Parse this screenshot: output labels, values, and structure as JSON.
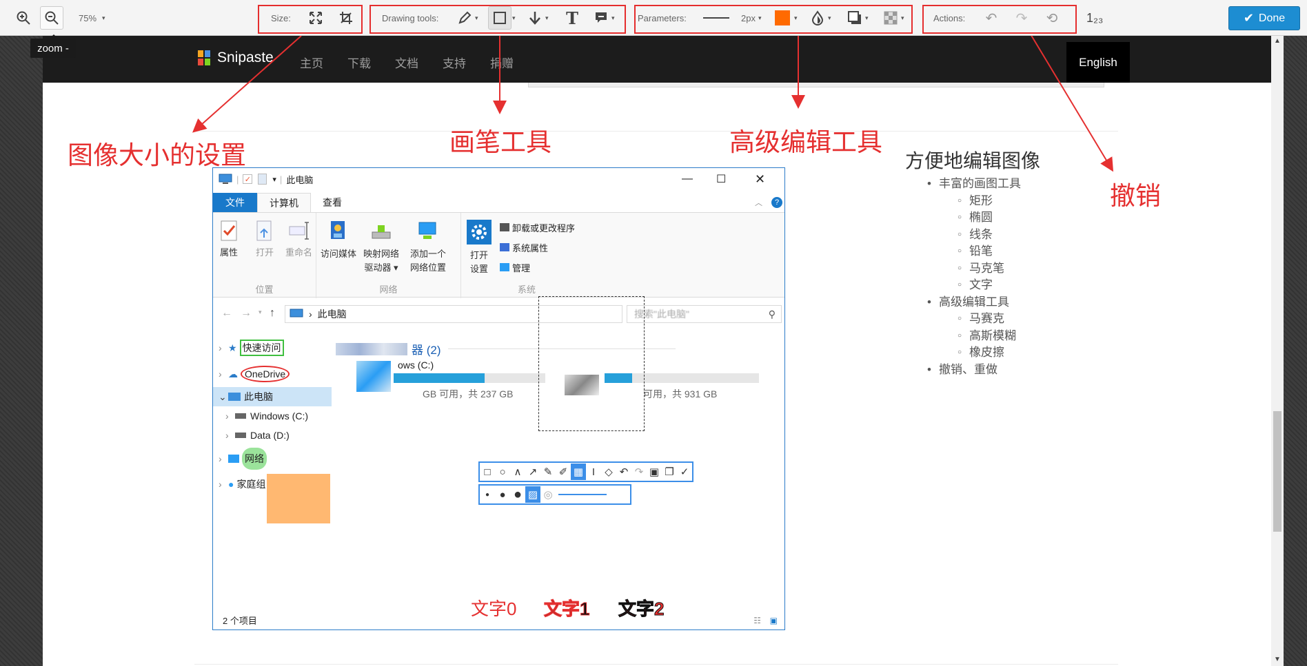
{
  "toolbar": {
    "zoom": "75%",
    "zoom_tooltip": "zoom -",
    "size_label": "Size:",
    "drawing_label": "Drawing tools:",
    "params_label": "Parameters:",
    "stroke_size": "2px",
    "actions_label": "Actions:",
    "step_label": "1₂₃",
    "done": "Done",
    "accent_color": "#ff6a00"
  },
  "site": {
    "logo": "Snipaste",
    "nav": [
      "主页",
      "下载",
      "文档",
      "支持",
      "捐赠"
    ],
    "lang": "English"
  },
  "annotations": {
    "size": "图像大小的设置",
    "pen": "画笔工具",
    "advanced": "高级编辑工具",
    "undo": "撤销"
  },
  "features": {
    "title": "方便地编辑图像",
    "g1": "丰富的画图工具",
    "g1_items": [
      "矩形",
      "椭圆",
      "线条",
      "铅笔",
      "马克笔",
      "文字"
    ],
    "g2": "高级编辑工具",
    "g2_items": [
      "马赛克",
      "高斯模糊",
      "橡皮擦"
    ],
    "g3": "撤销、重做"
  },
  "explorer": {
    "title": "此电脑",
    "tabs": [
      "文件",
      "计算机",
      "查看"
    ],
    "ribbon": {
      "loc_group": "位置",
      "net_group": "网络",
      "sys_group": "系统",
      "props": "属性",
      "open": "打开",
      "rename": "重命名",
      "media": "访问媒体",
      "map1": "映射网络",
      "map2": "驱动器 ▾",
      "add1": "添加一个",
      "add2": "网络位置",
      "open_set1": "打开",
      "open_set2": "设置",
      "uninstall": "卸载或更改程序",
      "sysprops": "系统属性",
      "manage": "管理"
    },
    "address": "此电脑",
    "search": "搜索\"此电脑\"",
    "tree": [
      "快速访问",
      "OneDrive",
      "此电脑",
      "Windows (C:)",
      "Data (D:)",
      "网络",
      "家庭组"
    ],
    "section": "器 (2)",
    "drive1": "ows (C:)",
    "drive1_info": "GB 可用，共 237 GB",
    "drive2_info": "可用，共 931 GB",
    "status": "2 个项目",
    "text0": "文字0",
    "text1": "文字1",
    "text2": "文字2"
  }
}
